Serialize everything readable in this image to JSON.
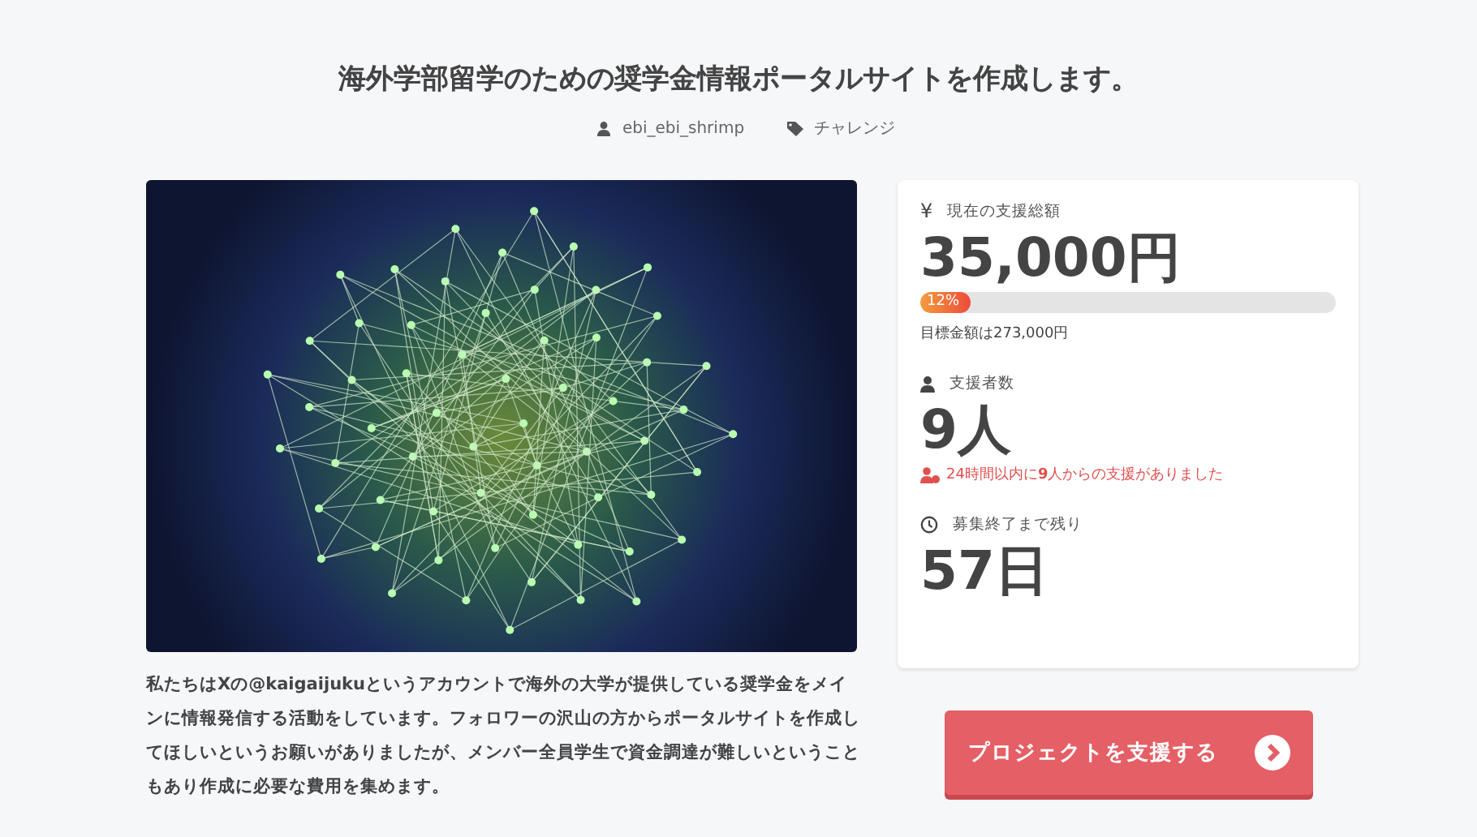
{
  "title": "海外学部留学のための奨学金情報ポータルサイトを作成します。",
  "meta": {
    "author": "ebi_ebi_shrimp",
    "category": "チャレンジ"
  },
  "stats": [
    {
      "kind": "amount",
      "icon": "¥",
      "label": "現在の支援総額",
      "value": "35,000円",
      "level": 0.12,
      "percent": "12%",
      "note": "目標金額は273,000円"
    },
    {
      "kind": "supporters",
      "label": "支援者数",
      "value": "9人",
      "note": "24時間以内に**9**人からの支援がありました"
    },
    {
      "kind": "remaining",
      "label": "募集終了まで残り",
      "value": "57日"
    }
  ],
  "description": "私たちはXの@kaigaijukuというアカウントで海外の大学が提供している奨学金をメインに情報発信する活動をしています。フォロワーの沢山の方からポータルサイトを作成してほしいというお願いがありましたが、メンバー全員学生で資金調達が難しいということもあり作成に必要な費用を集めます。",
  "support_button": "プロジェクトを支援する"
}
